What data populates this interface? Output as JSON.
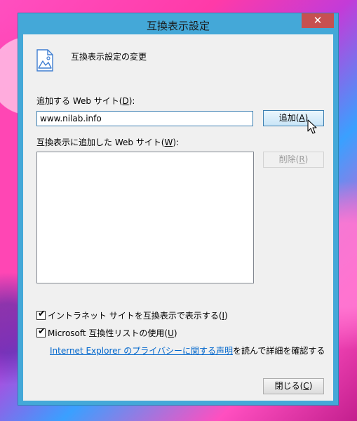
{
  "window": {
    "title": "互換表示設定",
    "close_glyph": "✕"
  },
  "header": {
    "icon": "image-document-icon",
    "text": "互換表示設定の変更"
  },
  "add_site": {
    "label_pre": "追加する Web サイト(",
    "label_key": "D",
    "label_post": "):",
    "input_value": "www.nilab.info",
    "button_pre": "追加(",
    "button_key": "A",
    "button_post": ")"
  },
  "added_sites": {
    "label_pre": "互換表示に追加した Web サイト(",
    "label_key": "W",
    "label_post": "):",
    "items": [],
    "remove_pre": "削除(",
    "remove_key": "R",
    "remove_post": ")"
  },
  "options": {
    "intranet": {
      "checked": true,
      "label_pre": "イントラネット サイトを互換表示で表示する(",
      "label_key": "I",
      "label_post": ")"
    },
    "ms_list": {
      "checked": true,
      "label_pre": "Microsoft 互換性リストの使用(",
      "label_key": "U",
      "label_post": ")"
    }
  },
  "privacy": {
    "link_text": "Internet Explorer のプライバシーに関する声明",
    "suffix": "を読んで詳細を確認する"
  },
  "footer": {
    "close_pre": "閉じる(",
    "close_key": "C",
    "close_post": ")"
  },
  "colors": {
    "window_frame": "#44a8d8",
    "close_button": "#c75050",
    "link": "#0066cc",
    "client_bg": "#f0f0f0"
  }
}
